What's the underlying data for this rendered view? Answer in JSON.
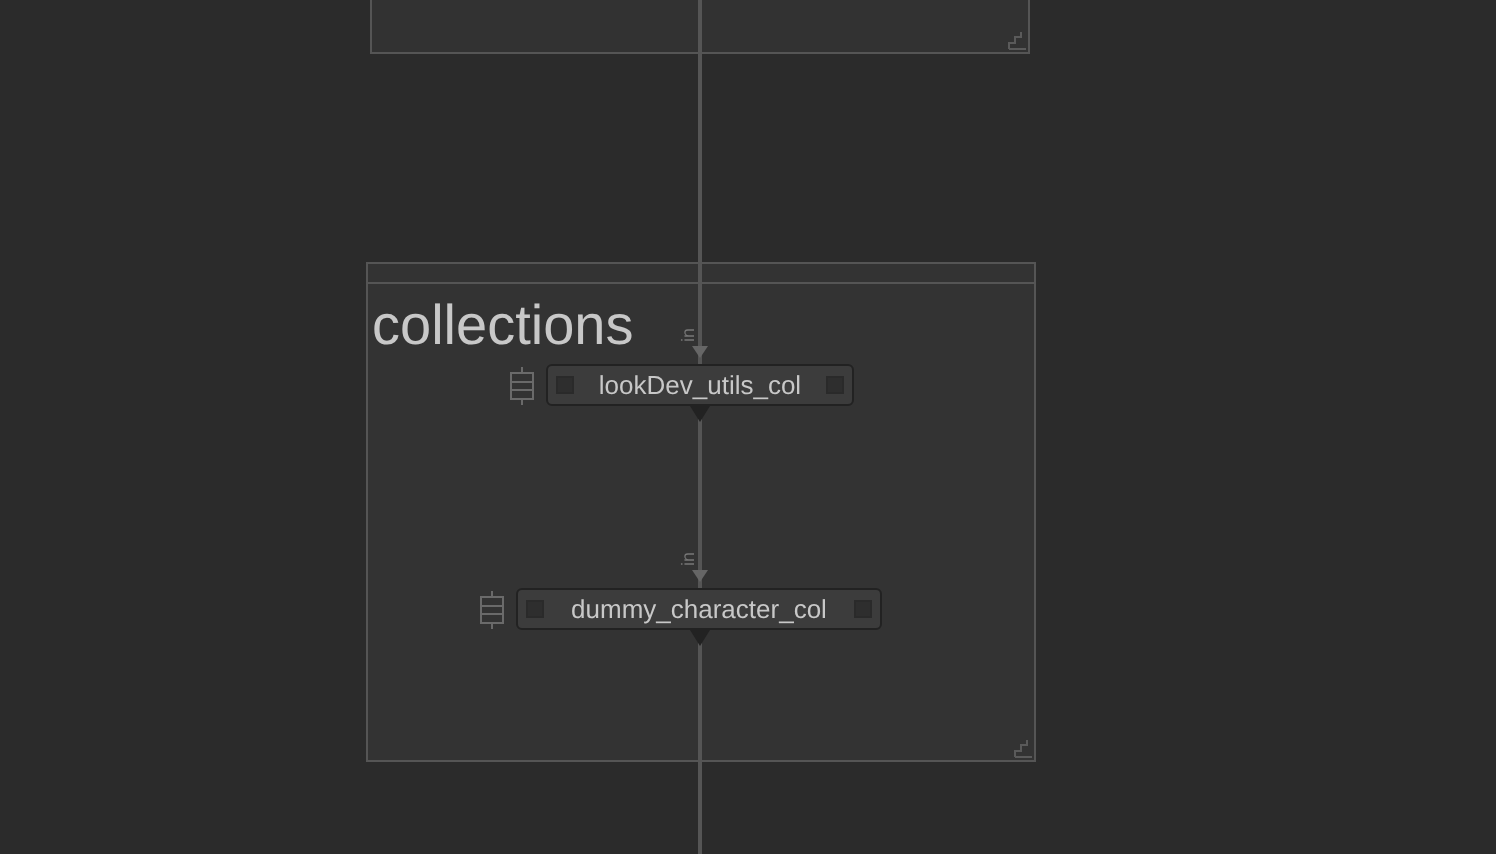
{
  "backdrops": [
    {
      "title": "collections"
    }
  ],
  "nodes": [
    {
      "name": "lookDev_utils_col",
      "input_label": "in"
    },
    {
      "name": "dummy_character_col",
      "input_label": "in"
    }
  ]
}
